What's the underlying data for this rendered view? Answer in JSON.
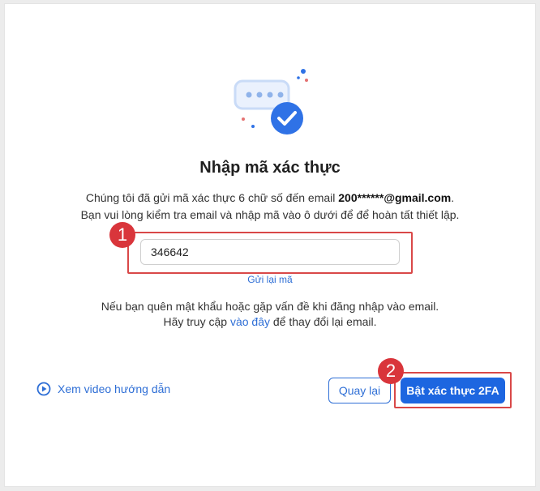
{
  "dialog": {
    "title": "Nhập mã xác thực",
    "description_prefix": "Chúng tôi đã gửi mã xác thực 6 chữ số đến email ",
    "email": "200******@gmail.com",
    "description_suffix": ".",
    "description_line2": "Bạn vui lòng kiểm tra email và nhập mã vào ô dưới để để hoàn tất thiết lập.",
    "code_value": "346642",
    "resend_label": "Gửi lại mã",
    "help_line1": "Nếu bạn quên mật khẩu hoặc gặp vấn đề khi đăng nhập vào email.",
    "help_line2_prefix": "Hãy truy cập ",
    "help_link": "vào đây",
    "help_line2_suffix": " để thay đổi lại email."
  },
  "footer": {
    "video_label": "Xem video hướng dẫn",
    "back_label": "Quay lại",
    "enable_label": "Bật xác thực 2FA"
  },
  "annotations": {
    "step1": "1",
    "step2": "2"
  },
  "colors": {
    "accent": "#1d66e0",
    "highlight": "#d94848",
    "link": "#2f6fd6"
  }
}
